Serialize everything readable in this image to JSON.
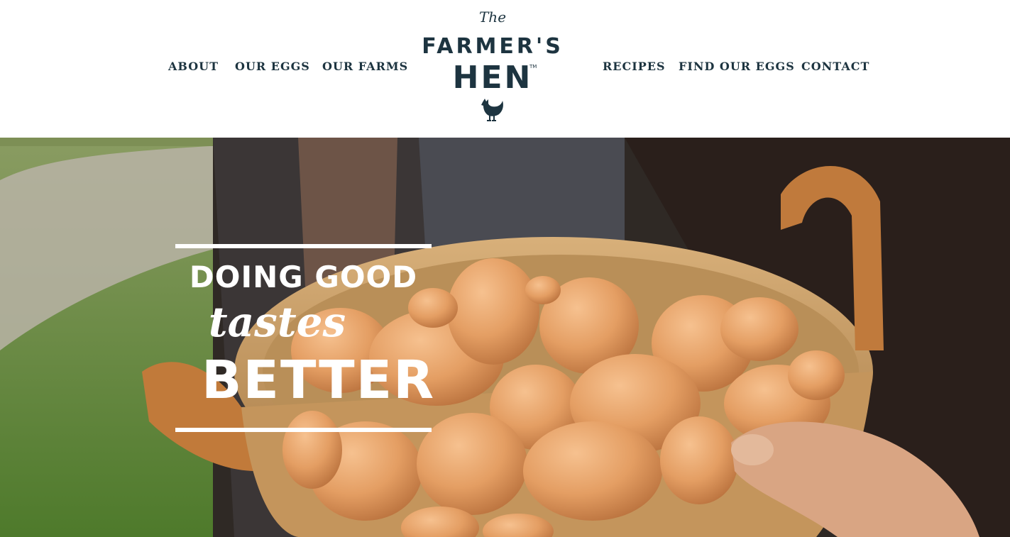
{
  "nav": {
    "left": [
      "ABOUT",
      "OUR EGGS",
      "OUR FARMS"
    ],
    "right": [
      "RECIPES",
      "FIND OUR EGGS",
      "CONTACT"
    ]
  },
  "logo": {
    "the": "The",
    "farmers": "FARMER'S",
    "hen": "HEN",
    "tm": "TM",
    "icon": "hen-icon"
  },
  "hero": {
    "line1": "DOING GOOD",
    "line2": "tastes",
    "line3": "BETTER",
    "image": "basket-of-brown-eggs"
  },
  "colors": {
    "brand_navy": "#1d3440",
    "egg": "#e5a26c",
    "basket": "#c99a5e",
    "grass": "#6f8e3c"
  }
}
